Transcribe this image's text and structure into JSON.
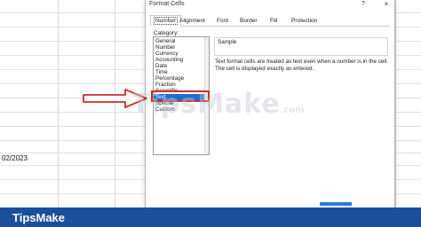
{
  "sheet": {
    "cell_value": "02/2023"
  },
  "dialog": {
    "title": "Format Cells",
    "help": "?",
    "close": "×",
    "tabs": [
      {
        "label": "Number",
        "active": true
      },
      {
        "label": "Alignment"
      },
      {
        "label": "Font"
      },
      {
        "label": "Border"
      },
      {
        "label": "Fill"
      },
      {
        "label": "Protection"
      }
    ],
    "category_label": "Category:",
    "categories": [
      "General",
      "Number",
      "Currency",
      "Accounting",
      "Date",
      "Time",
      "Percentage",
      "Fraction",
      "Scientific",
      "Text",
      "Special",
      "Custom"
    ],
    "selected_category": "Text",
    "sample_label": "Sample",
    "description_line1": "Text format cells are treated as text even when a number is in the cell.",
    "description_line2": "The cell is displayed exactly as entered."
  },
  "watermark": {
    "text": "TipsMake",
    "suffix": ".com"
  },
  "footer": {
    "logo": "TipsMake"
  },
  "colors": {
    "selection": "#1f6fd1",
    "highlight_border": "#d42a2a",
    "footer_bg": "#1b4f9c"
  }
}
